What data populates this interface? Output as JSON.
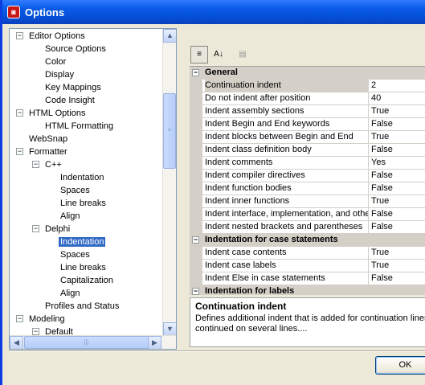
{
  "window": {
    "title": "Options",
    "app_icon": "delphi-app-icon"
  },
  "tree": {
    "items": [
      {
        "label": "Editor Options",
        "expander": "−"
      },
      {
        "label": "Source Options"
      },
      {
        "label": "Color"
      },
      {
        "label": "Display"
      },
      {
        "label": "Key Mappings"
      },
      {
        "label": "Code Insight"
      },
      {
        "label": "HTML Options",
        "expander": "−"
      },
      {
        "label": "HTML Formatting"
      },
      {
        "label": "WebSnap"
      },
      {
        "label": "Formatter",
        "expander": "−"
      },
      {
        "label": "C++",
        "expander": "−"
      },
      {
        "label": "Indentation"
      },
      {
        "label": "Spaces"
      },
      {
        "label": "Line breaks"
      },
      {
        "label": "Align"
      },
      {
        "label": "Delphi",
        "expander": "−"
      },
      {
        "label": "Indentation"
      },
      {
        "label": "Spaces"
      },
      {
        "label": "Line breaks"
      },
      {
        "label": "Capitalization"
      },
      {
        "label": "Align"
      },
      {
        "label": "Profiles and Status"
      },
      {
        "label": "Modeling",
        "expander": "−"
      },
      {
        "label": "Default",
        "expander": "−"
      }
    ],
    "selected_index": 16
  },
  "toolbar": {
    "categorized_icon": "≡",
    "sort_icon": "A↓",
    "pages_icon": "▤"
  },
  "grid": {
    "categories": [
      {
        "label": "General",
        "expander": "−",
        "rows": [
          {
            "name": "Continuation indent",
            "value": "2"
          },
          {
            "name": "Do not indent after position",
            "value": "40"
          },
          {
            "name": "Indent assembly sections",
            "value": "True"
          },
          {
            "name": "Indent Begin and End keywords",
            "value": "False"
          },
          {
            "name": "Indent blocks between Begin and End",
            "value": "True"
          },
          {
            "name": "Indent class definition body",
            "value": "False"
          },
          {
            "name": "Indent comments",
            "value": "Yes"
          },
          {
            "name": "Indent compiler directives",
            "value": "False"
          },
          {
            "name": "Indent function bodies",
            "value": "False"
          },
          {
            "name": "Indent inner functions",
            "value": "True"
          },
          {
            "name": "Indent interface, implementation, and other",
            "value": "False"
          },
          {
            "name": "Indent nested brackets and parentheses",
            "value": "False"
          }
        ]
      },
      {
        "label": "Indentation for case statements",
        "expander": "−",
        "rows": [
          {
            "name": "Indent case contents",
            "value": "True"
          },
          {
            "name": "Indent case labels",
            "value": "True"
          },
          {
            "name": "Indent Else in case statements",
            "value": "False"
          }
        ]
      },
      {
        "label": "Indentation for labels",
        "expander": "−",
        "rows": []
      }
    ]
  },
  "description": {
    "title": "Continuation indent",
    "text": "Defines additional indent that is added for continuation lines\ncontinued on several lines...."
  },
  "buttons": {
    "ok_label": "OK"
  }
}
